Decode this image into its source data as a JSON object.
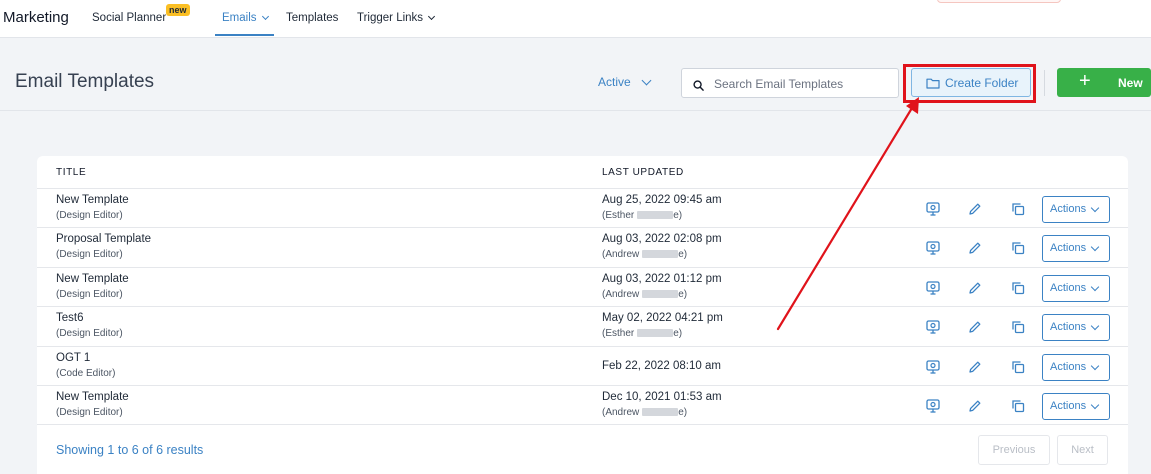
{
  "nav": {
    "brand": "Marketing",
    "items": [
      {
        "label": "Social Planner",
        "badge": "new"
      },
      {
        "label": "Emails"
      },
      {
        "label": "Templates"
      },
      {
        "label": "Trigger Links"
      }
    ]
  },
  "header": {
    "title": "Email Templates",
    "status_filter": "Active",
    "search_placeholder": "Search Email Templates",
    "create_folder_label": "Create Folder",
    "new_label": "New"
  },
  "table": {
    "columns": [
      "TITLE",
      "LAST UPDATED"
    ],
    "rows": [
      {
        "title": "New Template",
        "editor": "(Design Editor)",
        "date": "Aug 25, 2022 09:45 am",
        "user": "(Esther",
        "user_end": "e)"
      },
      {
        "title": "Proposal Template",
        "editor": "(Design Editor)",
        "date": "Aug 03, 2022 02:08 pm",
        "user": "(Andrew",
        "user_end": "e)"
      },
      {
        "title": "New Template",
        "editor": "(Design Editor)",
        "date": "Aug 03, 2022 01:12 pm",
        "user": "(Andrew",
        "user_end": "e)"
      },
      {
        "title": "Test6",
        "editor": "(Design Editor)",
        "date": "May 02, 2022 04:21 pm",
        "user": "(Esther",
        "user_end": "e)"
      },
      {
        "title": "OGT 1",
        "editor": "(Code Editor)",
        "date": "Feb 22, 2022 08:10 am",
        "user": "",
        "user_end": ""
      },
      {
        "title": "New Template",
        "editor": "(Design Editor)",
        "date": "Dec 10, 2021 01:53 am",
        "user": "(Andrew",
        "user_end": "e)"
      }
    ],
    "actions_label": "Actions"
  },
  "footer": {
    "showing": "Showing 1 to 6 of 6 results",
    "previous": "Previous",
    "next": "Next"
  },
  "colors": {
    "accent": "#3b82c4",
    "primary_green": "#38b048",
    "annotation_red": "#e0131b",
    "badge_yellow": "#fbbf24"
  },
  "icons": [
    "search-icon",
    "folder-icon",
    "plus-icon",
    "preview-icon",
    "edit-pencil-icon",
    "copy-icon",
    "chevron-down-icon"
  ]
}
